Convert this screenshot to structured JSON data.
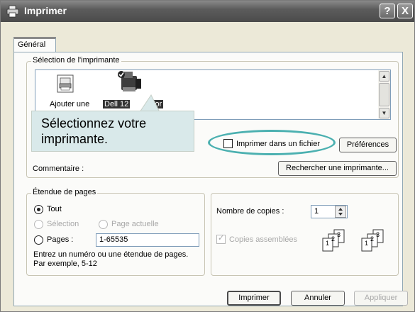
{
  "window": {
    "title": "Imprimer",
    "help_button": "?",
    "close_button": "X"
  },
  "tabs": [
    {
      "label": "Général"
    }
  ],
  "printer_selection": {
    "legend": "Sélection de l'imprimante",
    "items": [
      {
        "label": "Ajouter une",
        "icon": "add-printer-icon",
        "selected": false
      },
      {
        "label": "Dell 12",
        "label_end": "olor",
        "icon": "printer-icon",
        "selected": true
      }
    ]
  },
  "callout": {
    "line1": "Sélectionnez votre",
    "line2": "imprimante."
  },
  "print_to_file": {
    "label": "Imprimer dans un fichier",
    "checked": false
  },
  "preferences_button": "Préférences",
  "comment_label": "Commentaire :",
  "find_printer_button": "Rechercher une imprimante...",
  "page_range": {
    "legend": "Étendue de pages",
    "all": "Tout",
    "selection": "Sélection",
    "current_page": "Page actuelle",
    "pages": "Pages :",
    "pages_value": "1-65535",
    "help_line1": "Entrez un numéro ou une étendue de pages.",
    "help_line2": "Par exemple, 5-12",
    "selected": "all"
  },
  "copies": {
    "label": "Nombre de copies :",
    "value": "1",
    "collate_label": "Copies assemblées",
    "collate_checked": true,
    "collate_stack_labels": [
      "1",
      "2",
      "3"
    ]
  },
  "footer": {
    "print": "Imprimer",
    "cancel": "Annuler",
    "apply": "Appliquer"
  },
  "colors": {
    "callout_bg": "#d9e9ea",
    "highlight_oval": "#4bb0b0",
    "titlebar": "#5c5c5c"
  }
}
